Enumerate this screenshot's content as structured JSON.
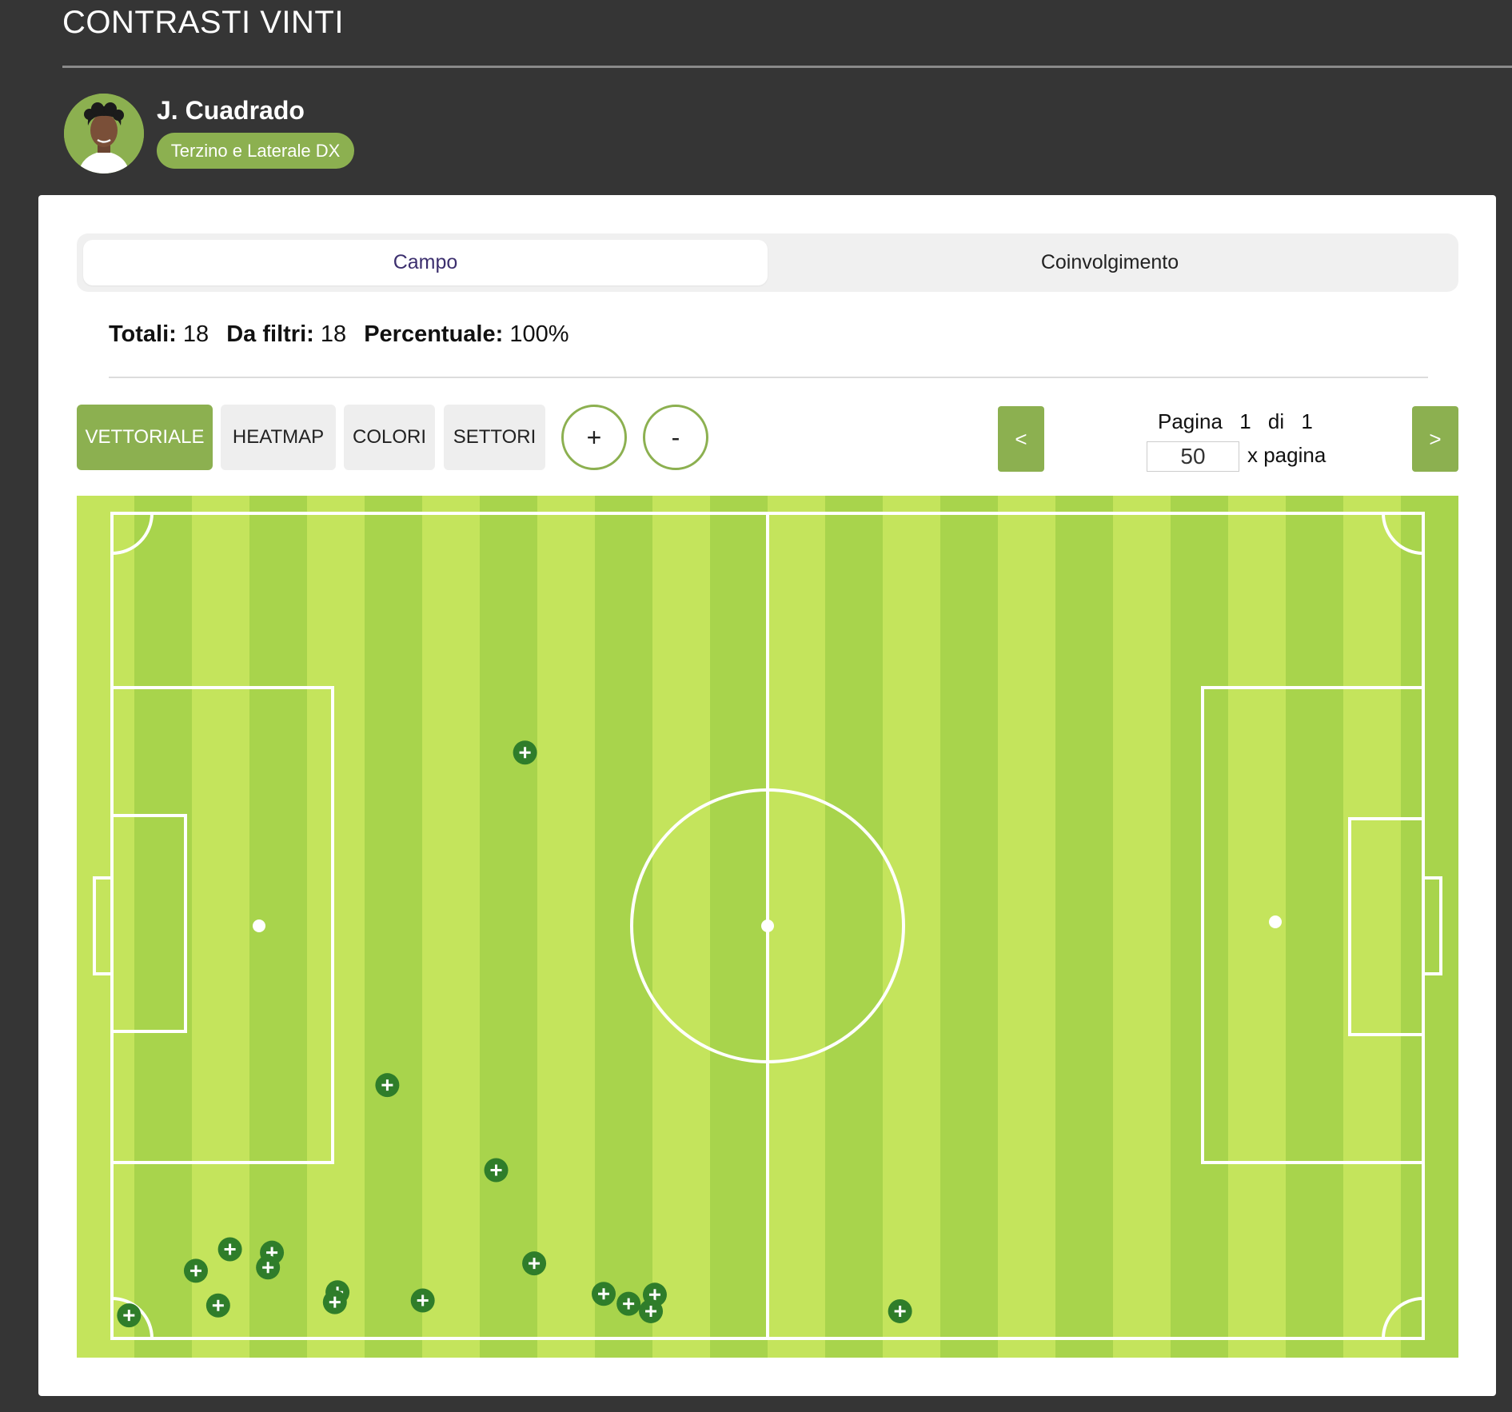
{
  "header": {
    "title": "CONTRASTI VINTI",
    "player": {
      "name": "J. Cuadrado",
      "role": "Terzino e Laterale DX"
    }
  },
  "tabs": [
    {
      "label": "Campo",
      "active": true
    },
    {
      "label": "Coinvolgimento",
      "active": false
    }
  ],
  "stats": {
    "totali_label": "Totali:",
    "totali_value": "18",
    "filtri_label": "Da filtri:",
    "filtri_value": "18",
    "percentuale_label": "Percentuale:",
    "percentuale_value": "100%"
  },
  "toolbar": {
    "views": [
      {
        "label": "VETTORIALE",
        "active": true
      },
      {
        "label": "HEATMAP",
        "active": false
      },
      {
        "label": "COLORI",
        "active": false
      },
      {
        "label": "SETTORI",
        "active": false
      }
    ],
    "zoom_in": "+",
    "zoom_out": "-"
  },
  "pagination": {
    "prev": "<",
    "next": ">",
    "page_label": "Pagina",
    "current": "1",
    "of_label": "di",
    "total": "1",
    "per_page_value": "50",
    "per_page_label": "x pagina"
  },
  "colors": {
    "accent_green": "#8cb050",
    "pitch_light": "#c4e45c",
    "pitch_dark": "#a8d44c",
    "marker": "#2f7d2a",
    "background": "#353535"
  },
  "chart_data": {
    "type": "scatter",
    "description_units": "pitch percent (0-100 along length, 0-100 along width from top)",
    "series": [
      {
        "points": [
          {
            "x": 31.5,
            "y": 29.0
          },
          {
            "x": 21.0,
            "y": 69.3
          },
          {
            "x": 29.3,
            "y": 79.6
          },
          {
            "x": 9.0,
            "y": 89.2
          },
          {
            "x": 12.2,
            "y": 89.6
          },
          {
            "x": 6.4,
            "y": 91.8
          },
          {
            "x": 11.9,
            "y": 91.4
          },
          {
            "x": 17.2,
            "y": 94.4
          },
          {
            "x": 17.0,
            "y": 95.6
          },
          {
            "x": 8.1,
            "y": 96.0
          },
          {
            "x": 23.7,
            "y": 95.4
          },
          {
            "x": 32.2,
            "y": 90.9
          },
          {
            "x": 37.5,
            "y": 94.6
          },
          {
            "x": 39.4,
            "y": 95.8
          },
          {
            "x": 41.4,
            "y": 94.7
          },
          {
            "x": 41.1,
            "y": 96.7
          },
          {
            "x": 60.1,
            "y": 96.7
          },
          {
            "x": 1.3,
            "y": 97.2
          }
        ]
      }
    ]
  }
}
